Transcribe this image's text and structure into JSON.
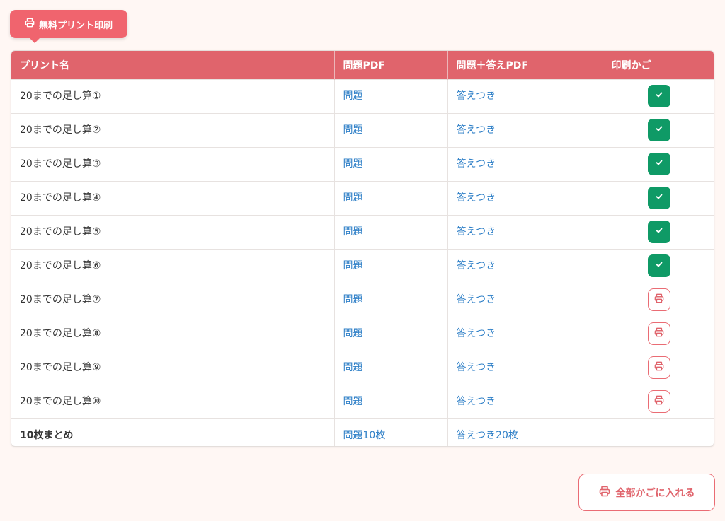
{
  "badge": {
    "label": "無料プリント印刷",
    "icon": "printer-icon"
  },
  "table": {
    "headers": [
      "プリント名",
      "問題PDF",
      "問題＋答えPDF",
      "印刷かご"
    ],
    "rows": [
      {
        "name": "20までの足し算①",
        "problem": "問題",
        "answer": "答えつき",
        "in_cart": true
      },
      {
        "name": "20までの足し算②",
        "problem": "問題",
        "answer": "答えつき",
        "in_cart": true
      },
      {
        "name": "20までの足し算③",
        "problem": "問題",
        "answer": "答えつき",
        "in_cart": true
      },
      {
        "name": "20までの足し算④",
        "problem": "問題",
        "answer": "答えつき",
        "in_cart": true
      },
      {
        "name": "20までの足し算⑤",
        "problem": "問題",
        "answer": "答えつき",
        "in_cart": true
      },
      {
        "name": "20までの足し算⑥",
        "problem": "問題",
        "answer": "答えつき",
        "in_cart": true
      },
      {
        "name": "20までの足し算⑦",
        "problem": "問題",
        "answer": "答えつき",
        "in_cart": false
      },
      {
        "name": "20までの足し算⑧",
        "problem": "問題",
        "answer": "答えつき",
        "in_cart": false
      },
      {
        "name": "20までの足し算⑨",
        "problem": "問題",
        "answer": "答えつき",
        "in_cart": false
      },
      {
        "name": "20までの足し算⑩",
        "problem": "問題",
        "answer": "答えつき",
        "in_cart": false
      }
    ],
    "summary": {
      "name": "10枚まとめ",
      "problem": "問題10枚",
      "answer": "答えつき20枚"
    }
  },
  "add_all_button": {
    "label": "全部かごに入れる",
    "icon": "printer-icon"
  },
  "colors": {
    "accent": "#e0646c",
    "check": "#0f9a66",
    "link": "#2e7fc7",
    "background": "#fff7f4"
  }
}
